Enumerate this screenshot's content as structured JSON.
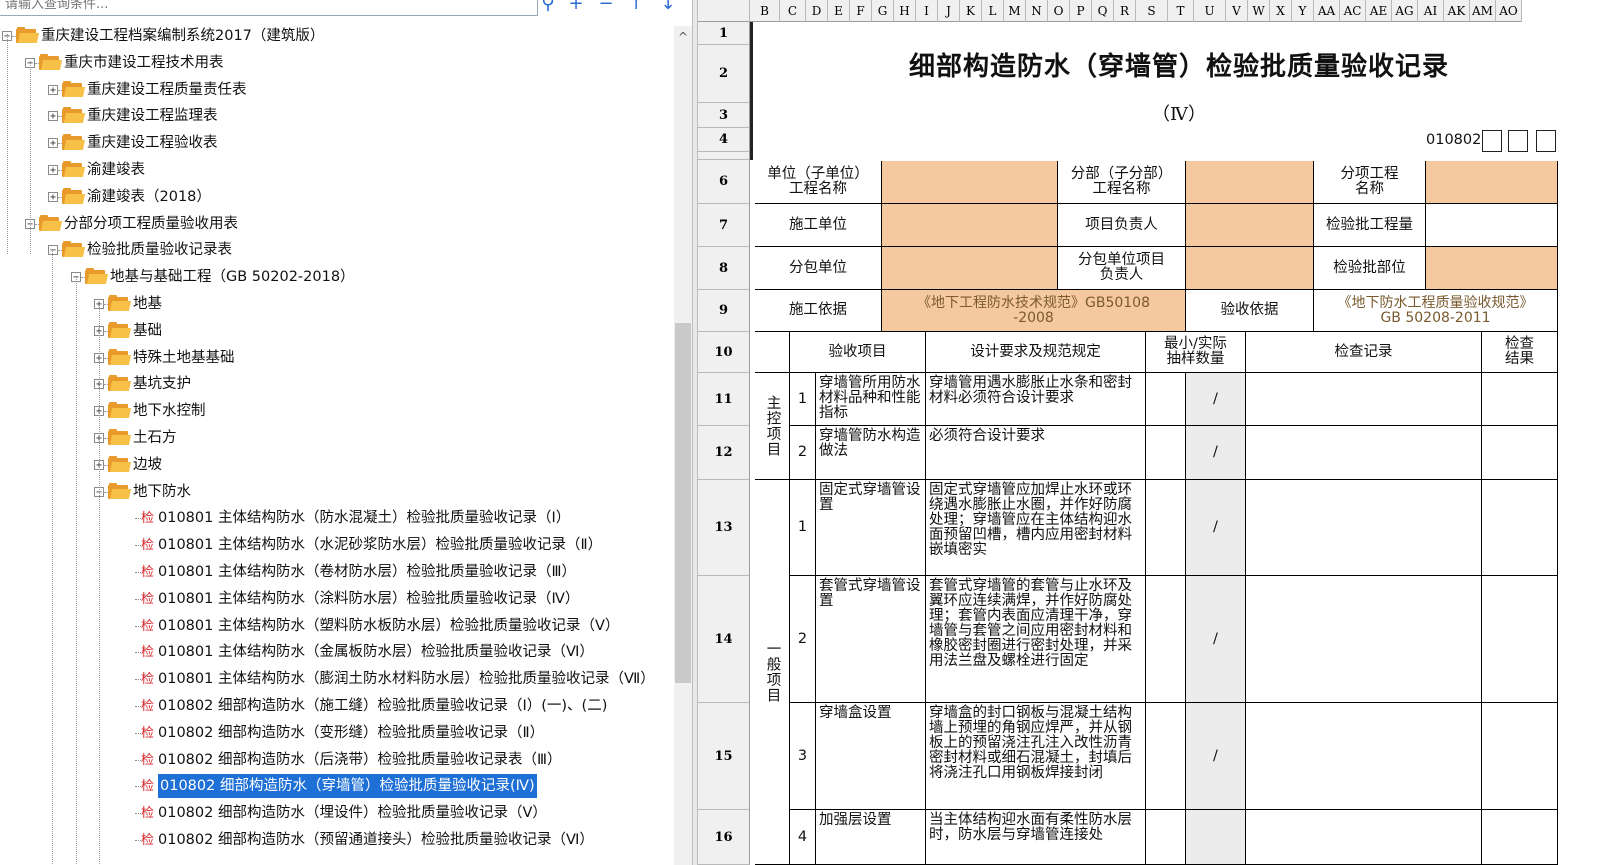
{
  "search": {
    "placeholder": "请输入查询条件..."
  },
  "toolbar_icons": [
    "search-icon",
    "plus-icon",
    "minus-icon",
    "arrow-up-icon",
    "arrow-down-icon"
  ],
  "tree": [
    {
      "label": "重庆建设工程档案编制系统2017（建筑版）",
      "level": 0,
      "type": "folder",
      "exp": "-"
    },
    {
      "label": "重庆市建设工程技术用表",
      "level": 1,
      "type": "folder",
      "exp": "-"
    },
    {
      "label": "重庆建设工程质量责任表",
      "level": 2,
      "type": "folder",
      "exp": "+"
    },
    {
      "label": "重庆建设工程监理表",
      "level": 2,
      "type": "folder",
      "exp": "+"
    },
    {
      "label": "重庆建设工程验收表",
      "level": 2,
      "type": "folder",
      "exp": "+"
    },
    {
      "label": "渝建竣表",
      "level": 2,
      "type": "folder",
      "exp": "+"
    },
    {
      "label": "渝建竣表（2018）",
      "level": 2,
      "type": "folder",
      "exp": "+"
    },
    {
      "label": "分部分项工程质量验收用表",
      "level": 1,
      "type": "folder",
      "exp": "-"
    },
    {
      "label": "检验批质量验收记录表",
      "level": 2,
      "type": "folder",
      "exp": "-"
    },
    {
      "label": "地基与基础工程（GB 50202-2018）",
      "level": 3,
      "type": "folder",
      "exp": "-"
    },
    {
      "label": "地基",
      "level": 4,
      "type": "folder",
      "exp": "+"
    },
    {
      "label": "基础",
      "level": 4,
      "type": "folder",
      "exp": "+"
    },
    {
      "label": "特殊土地基基础",
      "level": 4,
      "type": "folder",
      "exp": "+"
    },
    {
      "label": "基坑支护",
      "level": 4,
      "type": "folder",
      "exp": "+"
    },
    {
      "label": "地下水控制",
      "level": 4,
      "type": "folder",
      "exp": "+"
    },
    {
      "label": "土石方",
      "level": 4,
      "type": "folder",
      "exp": "+"
    },
    {
      "label": "边坡",
      "level": 4,
      "type": "folder",
      "exp": "+"
    },
    {
      "label": "地下防水",
      "level": 4,
      "type": "folder",
      "exp": "-"
    },
    {
      "label": "010801 主体结构防水（防水混凝土）检验批质量验收记录（Ⅰ）",
      "level": 5,
      "type": "doc"
    },
    {
      "label": "010801 主体结构防水（水泥砂浆防水层）检验批质量验收记录（Ⅱ）",
      "level": 5,
      "type": "doc"
    },
    {
      "label": "010801 主体结构防水（卷材防水层）检验批质量验收记录（Ⅲ）",
      "level": 5,
      "type": "doc"
    },
    {
      "label": "010801 主体结构防水（涂料防水层）检验批质量验收记录（Ⅳ）",
      "level": 5,
      "type": "doc"
    },
    {
      "label": "010801 主体结构防水（塑料防水板防水层）检验批质量验收记录（Ⅴ）",
      "level": 5,
      "type": "doc"
    },
    {
      "label": "010801 主体结构防水（金属板防水层）检验批质量验收记录（Ⅵ）",
      "level": 5,
      "type": "doc"
    },
    {
      "label": "010801 主体结构防水（膨润土防水材料防水层）检验批质量验收记录（Ⅶ）",
      "level": 5,
      "type": "doc"
    },
    {
      "label": "010802 细部构造防水（施工缝）检验批质量验收记录（Ⅰ）(一)、(二)",
      "level": 5,
      "type": "doc"
    },
    {
      "label": "010802 细部构造防水（变形缝）检验批质量验收记录（Ⅱ）",
      "level": 5,
      "type": "doc"
    },
    {
      "label": "010802 细部构造防水（后浇带）检验批质量验收记录表（Ⅲ）",
      "level": 5,
      "type": "doc"
    },
    {
      "label": "010802 细部构造防水（穿墙管）检验批质量验收记录(Ⅳ)",
      "level": 5,
      "type": "doc",
      "selected": true
    },
    {
      "label": "010802 细部构造防水（埋设件）检验批质量验收记录（Ⅴ）",
      "level": 5,
      "type": "doc"
    },
    {
      "label": "010802 细部构造防水（预留通道接头）检验批质量验收记录（Ⅵ）",
      "level": 5,
      "type": "doc"
    }
  ],
  "doc_icon_char": "检",
  "sheet": {
    "columns": [
      "B",
      "C",
      "D",
      "E",
      "F",
      "G",
      "H",
      "I",
      "J",
      "K",
      "L",
      "M",
      "N",
      "O",
      "P",
      "Q",
      "R",
      "S",
      "T",
      "U",
      "V",
      "W",
      "X",
      "Y",
      "AA",
      "AC",
      "AE",
      "AG",
      "AI",
      "AK",
      "AM",
      "AO"
    ],
    "rows": [
      "1",
      "2",
      "3",
      "4",
      "5",
      "6",
      "7",
      "8",
      "9",
      "10",
      "11",
      "12",
      "13",
      "14",
      "15",
      "16"
    ],
    "title": "细部构造防水（穿墙管）检验批质量验收记录",
    "subtitle": "（Ⅳ）",
    "code": "010802",
    "r6": {
      "a": "单位（子单位）\n工程名称",
      "b": "分部（子分部）\n工程名称",
      "c": "分项工程\n名称"
    },
    "r7": {
      "a": "施工单位",
      "b": "项目负责人",
      "c": "检验批工程量"
    },
    "r8": {
      "a": "分包单位",
      "b": "分包单位项目\n负责人",
      "c": "检验批部位"
    },
    "r9": {
      "a": "施工依据",
      "a_val": "《地下工程防水技术规范》GB50108\n-2008",
      "b": "验收依据",
      "b_val": "《地下防水工程质量验收规范》\nGB 50208-2011"
    },
    "r10": {
      "item": "验收项目",
      "req": "设计要求及规范规定",
      "qty": "最小/实际\n抽样数量",
      "rec": "检查记录",
      "res": "检查\n结果"
    },
    "group_main": "主控项目",
    "group_general": "一般项目",
    "items": [
      {
        "no": "1",
        "name": "穿墙管所用防水材料品种和性能指标",
        "req": "穿墙管用遇水膨胀止水条和密封材料必须符合设计要求",
        "slash": "/"
      },
      {
        "no": "2",
        "name": "穿墙管防水构造做法",
        "req": "必须符合设计要求",
        "slash": "/"
      },
      {
        "no": "1",
        "name": "固定式穿墙管设置",
        "req": "固定式穿墙管应加焊止水环或环绕遇水膨胀止水圈，并作好防腐处理；穿墙管应在主体结构迎水面预留凹槽，槽内应用密封材料嵌填密实",
        "slash": "/"
      },
      {
        "no": "2",
        "name": "套管式穿墙管设置",
        "req": "套管式穿墙管的套管与止水环及翼环应连续满焊，并作好防腐处理；套管内表面应清理干净，穿墙管与套管之间应用密封材料和橡胶密封圈进行密封处理，并采用法兰盘及螺栓进行固定",
        "slash": "/"
      },
      {
        "no": "3",
        "name": "穿墙盒设置",
        "req": "穿墙盒的封口钢板与混凝土结构墙上预埋的角钢应焊严，并从钢板上的预留浇注孔注入改性沥青密封材料或细石混凝土，封填后将浇注孔口用钢板焊接封闭",
        "slash": "/"
      },
      {
        "no": "4",
        "name": "加强层设置",
        "req": "当主体结构迎水面有柔性防水层时，防水层与穿墙管连接处",
        "slash": ""
      }
    ]
  }
}
